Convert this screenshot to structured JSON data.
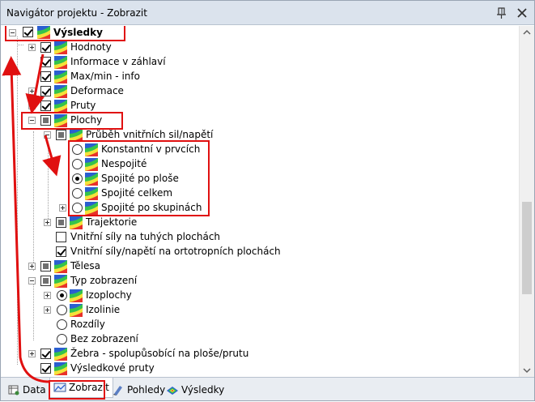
{
  "window": {
    "title": "Navigátor projektu - Zobrazit"
  },
  "tree": {
    "root": {
      "label": "Výsledky",
      "state": "checked"
    },
    "items": [
      {
        "label": "Hodnoty",
        "state": "checked"
      },
      {
        "label": "Informace v záhlaví",
        "state": "checked"
      },
      {
        "label": "Max/min - info",
        "state": "checked"
      },
      {
        "label": "Deformace",
        "state": "checked"
      },
      {
        "label": "Pruty",
        "state": "checked"
      },
      {
        "label": "Plochy",
        "state": "partial"
      },
      {
        "label": "Průběh vnitřních sil/napětí",
        "state": "partial"
      },
      {
        "label": "Konstantní v prvcích",
        "state": "radio-off"
      },
      {
        "label": "Nespojité",
        "state": "radio-off"
      },
      {
        "label": "Spojité po ploše",
        "state": "radio-on"
      },
      {
        "label": "Spojité celkem",
        "state": "radio-off"
      },
      {
        "label": "Spojité po skupinách",
        "state": "radio-off"
      },
      {
        "label": "Trajektorie",
        "state": "partial"
      },
      {
        "label": "Vnitřní síly na tuhých plochách",
        "state": "unchecked"
      },
      {
        "label": "Vnitřní síly/napětí na ortotropních plochách",
        "state": "checked"
      },
      {
        "label": "Tělesa",
        "state": "partial"
      },
      {
        "label": "Typ zobrazení",
        "state": "partial"
      },
      {
        "label": "Izoplochy",
        "state": "radio-on"
      },
      {
        "label": "Izolinie",
        "state": "radio-off"
      },
      {
        "label": "Rozdíly",
        "state": "radio-off"
      },
      {
        "label": "Bez zobrazení",
        "state": "radio-off"
      },
      {
        "label": "Žebra - spolupůsobící na ploše/prutu",
        "state": "checked"
      },
      {
        "label": "Výsledkové pruty",
        "state": "checked"
      }
    ]
  },
  "tabs": [
    {
      "label": "Data",
      "icon": "data-icon"
    },
    {
      "label": "Zobrazit",
      "icon": "display-icon",
      "active": true
    },
    {
      "label": "Pohledy",
      "icon": "views-icon"
    },
    {
      "label": "Výsledky",
      "icon": "results-icon"
    }
  ],
  "colors": {
    "highlight": "#e01010",
    "titlebar": "#dbe3ed",
    "tabbar": "#e9edf2"
  }
}
